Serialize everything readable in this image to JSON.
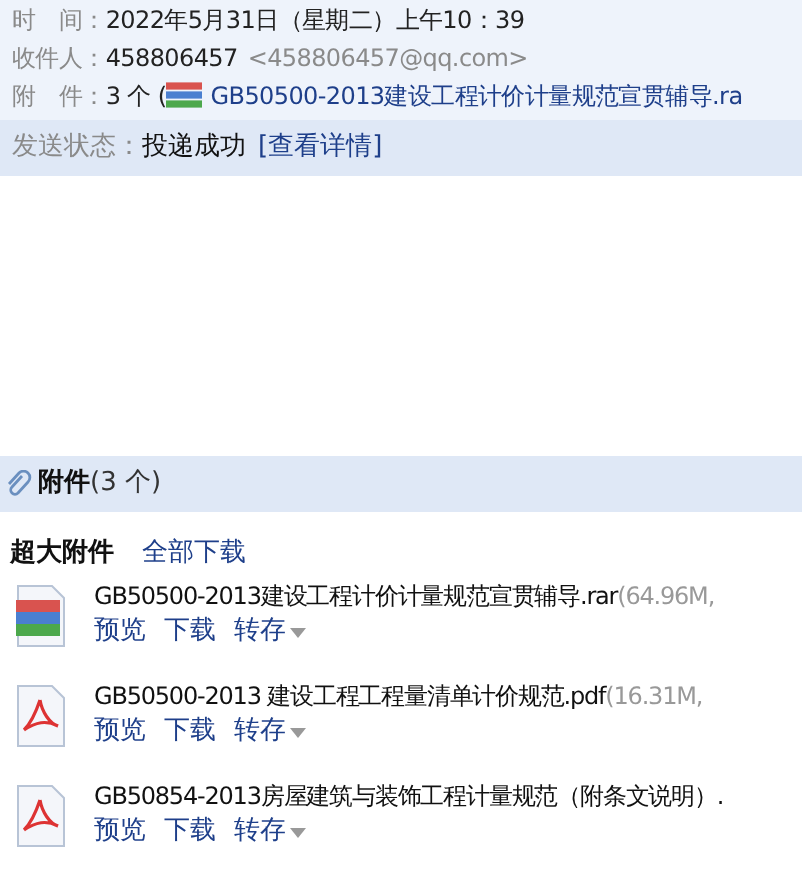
{
  "header": {
    "fields": [
      {
        "label": "时　间：",
        "value": "2022年5月31日（星期二）上午10：39"
      },
      {
        "label": "收件人：",
        "value": "458806457",
        "extra": "<458806457@qq.com>"
      },
      {
        "label": "附　件：",
        "value": "3 个 (",
        "attachment_link": "GB50500-2013建设工程计价计量规范宣贯辅导.ra"
      }
    ],
    "send_status": {
      "label": "发送状态：",
      "value": "投递成功",
      "link": "[查看详情]"
    }
  },
  "attachments": {
    "title": "附件",
    "count": "(3 个)",
    "group_title": "超大附件",
    "download_all": "全部下载",
    "files": [
      {
        "kind": "archive",
        "name": "GB50500-2013建设工程计价计量规范宣贯辅导.rar",
        "meta": "(64.96M,",
        "actions": [
          "预览",
          "下载",
          "转存"
        ]
      },
      {
        "kind": "pdf",
        "name": "GB50500-2013 建设工程工程量清单计价规范.pdf",
        "meta": "(16.31M,",
        "actions": [
          "预览",
          "下载",
          "转存"
        ]
      },
      {
        "kind": "pdf",
        "name": "GB50854-2013房屋建筑与装饰工程计量规范（附条文说明）.",
        "actions": [
          "预览",
          "下载",
          "转存"
        ]
      }
    ]
  }
}
